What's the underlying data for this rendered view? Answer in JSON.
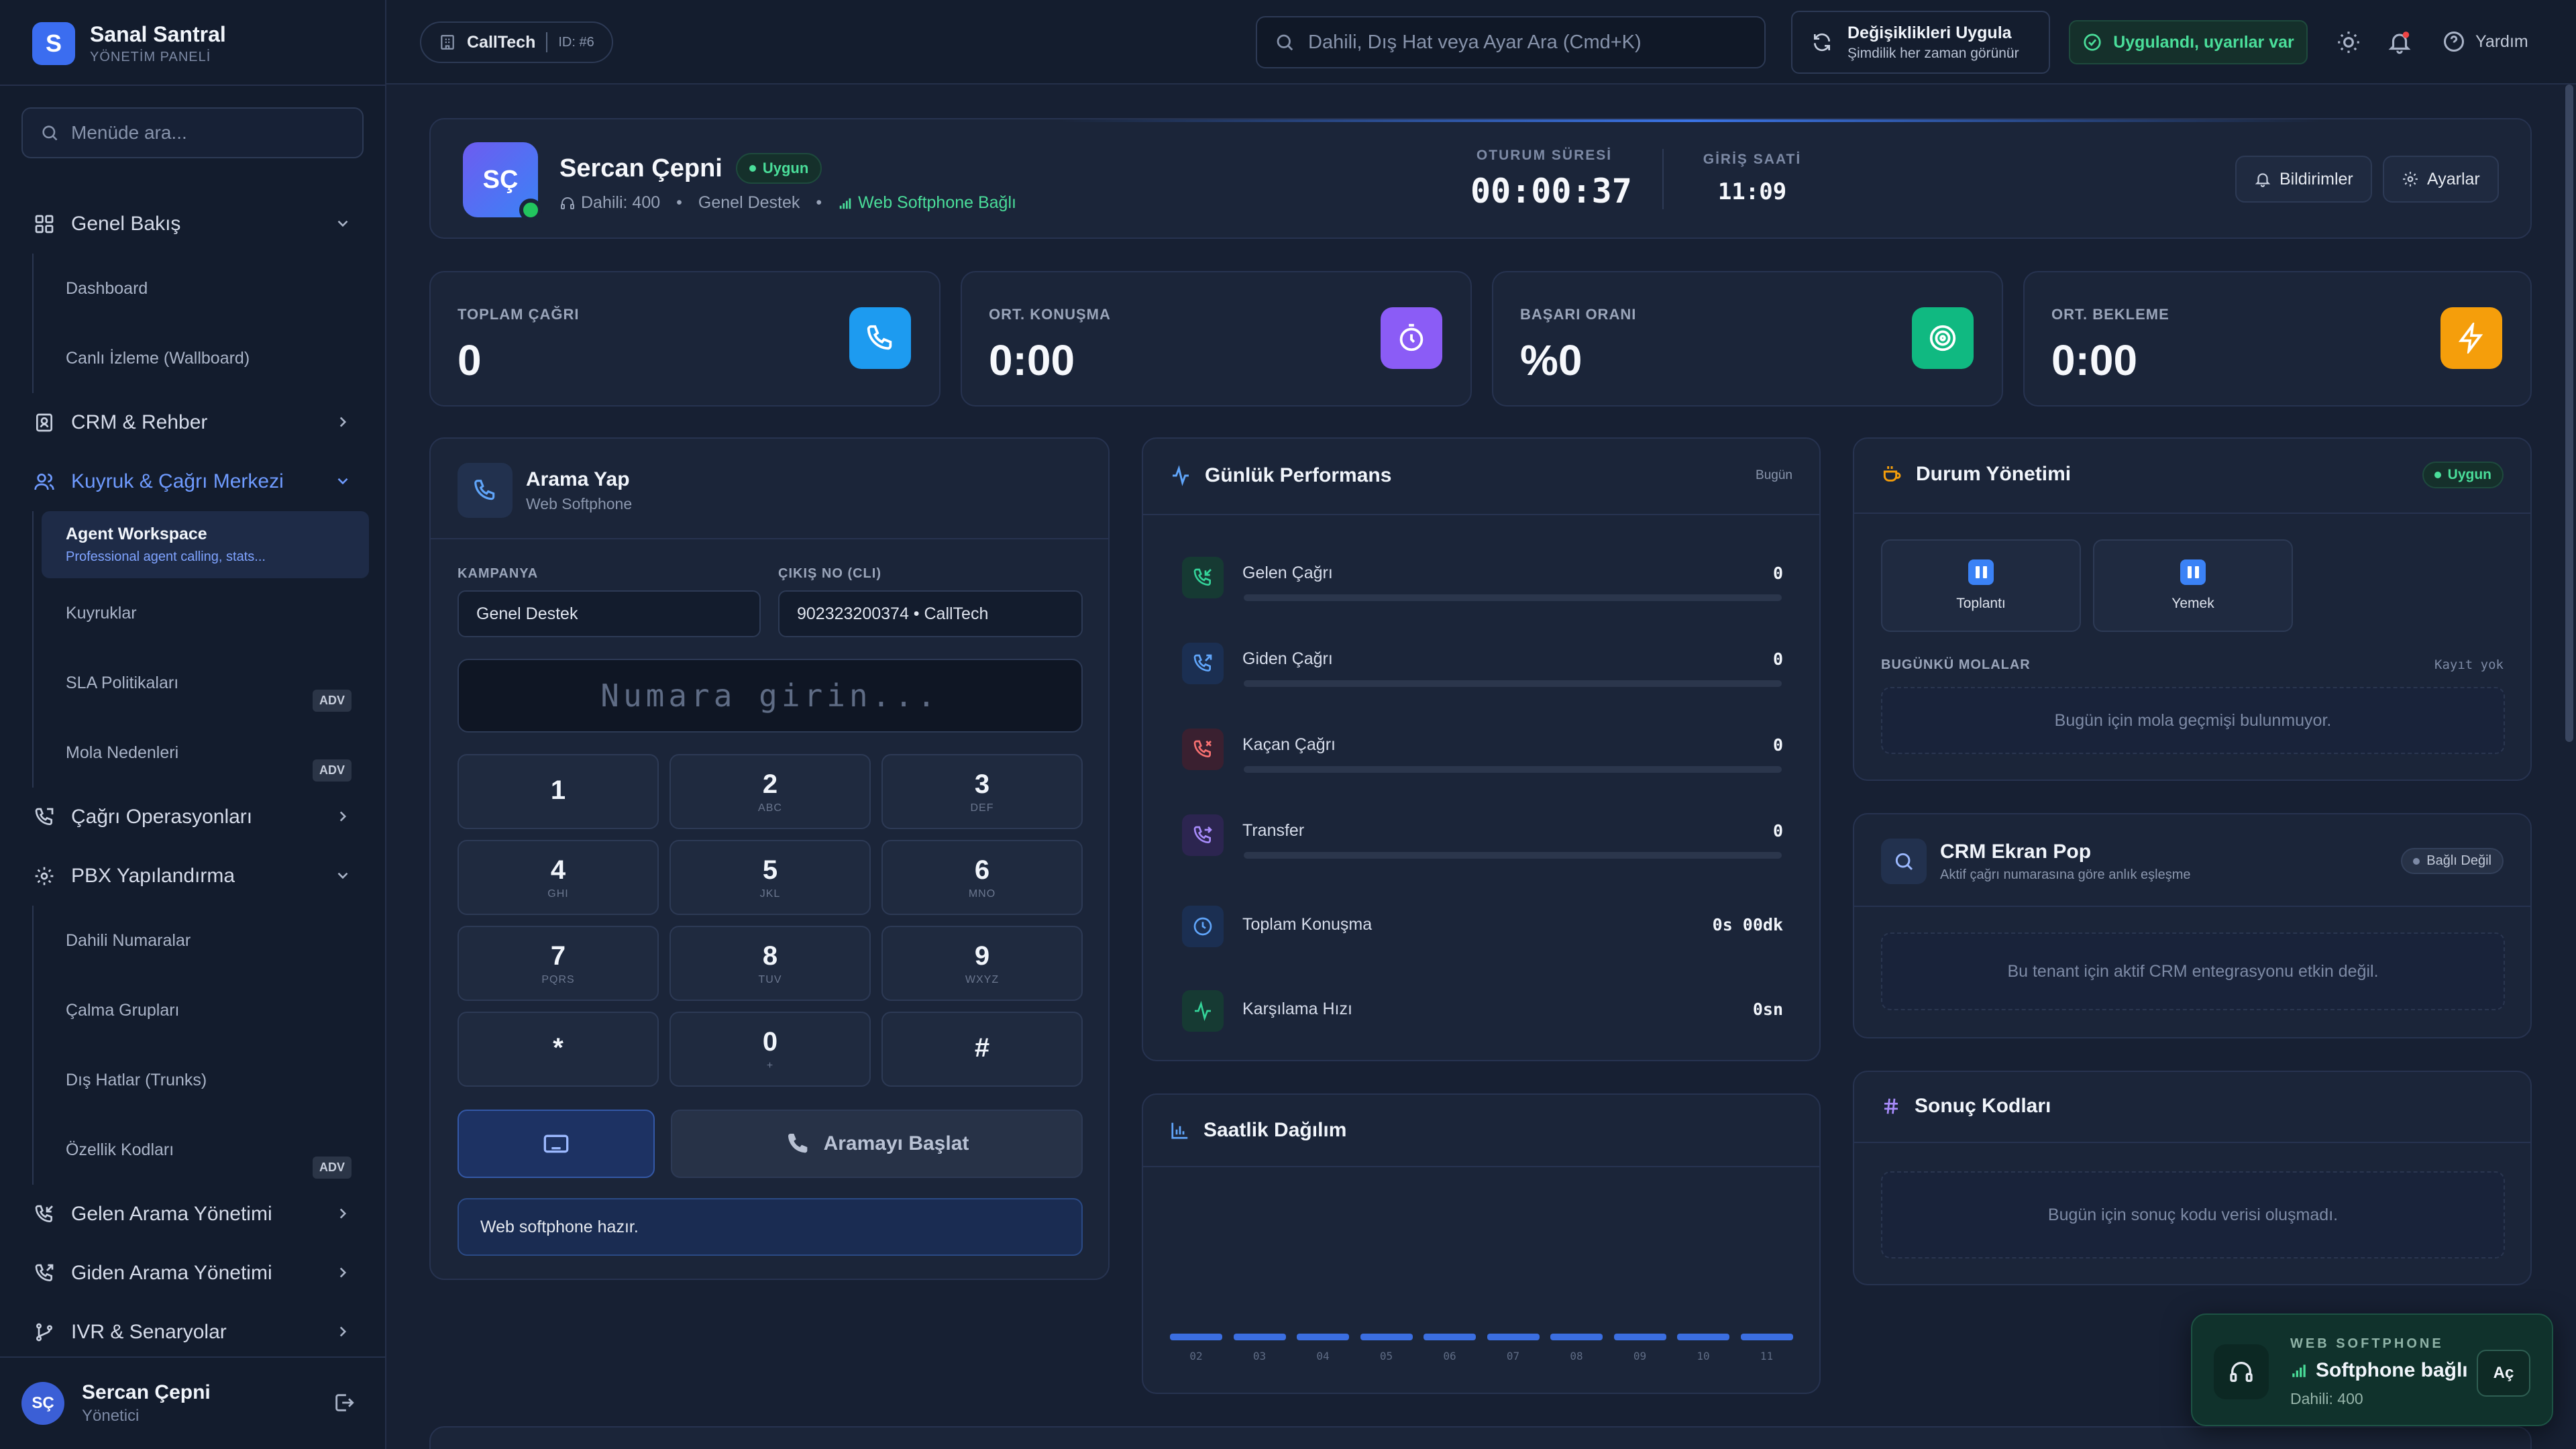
{
  "brand": {
    "logo_letter": "S",
    "name": "Sanal Santral",
    "subtitle": "YÖNETİM PANELİ"
  },
  "sidebar": {
    "search_placeholder": "Menüde ara...",
    "groups": [
      {
        "label": "Genel Bakış",
        "icon": "grid-icon",
        "expanded": true,
        "items": [
          {
            "label": "Dashboard"
          },
          {
            "label": "Canlı İzleme (Wallboard)"
          }
        ]
      },
      {
        "label": "CRM & Rehber",
        "icon": "contact-book-icon",
        "expanded": false
      },
      {
        "label": "Kuyruk & Çağrı Merkezi",
        "icon": "users-icon",
        "expanded": true,
        "active": true,
        "items": [
          {
            "label": "Agent Workspace",
            "sub": "Professional agent calling, stats...",
            "selected": true
          },
          {
            "label": "Kuyruklar"
          },
          {
            "label": "SLA Politikaları",
            "badge": "ADV"
          },
          {
            "label": "Mola Nedenleri",
            "badge": "ADV"
          }
        ]
      },
      {
        "label": "Çağrı Operasyonları",
        "icon": "phone-icon",
        "expanded": false
      },
      {
        "label": "PBX Yapılandırma",
        "icon": "gear-icon",
        "expanded": true,
        "items": [
          {
            "label": "Dahili Numaralar"
          },
          {
            "label": "Çalma Grupları"
          },
          {
            "label": "Dış Hatlar (Trunks)"
          },
          {
            "label": "Özellik Kodları",
            "badge": "ADV"
          }
        ]
      },
      {
        "label": "Gelen Arama Yönetimi",
        "icon": "phone-incoming-icon",
        "expanded": false
      },
      {
        "label": "Giden Arama Yönetimi",
        "icon": "phone-outgoing-icon",
        "expanded": false
      },
      {
        "label": "IVR & Senaryolar",
        "icon": "branch-icon",
        "expanded": false
      }
    ],
    "user": {
      "initials": "SÇ",
      "name": "Sercan Çepni",
      "role": "Yönetici"
    }
  },
  "topbar": {
    "tenant": "CallTech",
    "tenant_id": "ID: #6",
    "search_placeholder": "Dahili, Dış Hat veya Ayar Ara (Cmd+K)",
    "apply_title": "Değişiklikleri Uygula",
    "apply_sub": "Şimdilik her zaman görünür",
    "status": "Uygulandı, uyarılar var",
    "help": "Yardım"
  },
  "profile": {
    "initials": "SÇ",
    "name": "Sercan Çepni",
    "status": "Uygun",
    "extension": "Dahili: 400",
    "queue": "Genel Destek",
    "softphone": "Web Softphone Bağlı",
    "session_label": "OTURUM SÜRESİ",
    "session_value": "00:00:37",
    "login_label": "GİRİŞ SAATİ",
    "login_value": "11:09",
    "notifications_btn": "Bildirimler",
    "settings_btn": "Ayarlar"
  },
  "stats": [
    {
      "label": "TOPLAM ÇAĞRI",
      "value": "0",
      "icon": "phone-icon",
      "color": "#1d9bf0"
    },
    {
      "label": "ORT. KONUŞMA",
      "value": "0:00",
      "icon": "stopwatch-icon",
      "color": "#8b5cf6"
    },
    {
      "label": "BAŞARI ORANI",
      "value": "%0",
      "icon": "target-icon",
      "color": "#10b981"
    },
    {
      "label": "ORT. BEKLEME",
      "value": "0:00",
      "icon": "lightning-icon",
      "color": "#f59e0b"
    }
  ],
  "dialer": {
    "title": "Arama Yap",
    "subtitle": "Web Softphone",
    "campaign_label": "KAMPANYA",
    "campaign_value": "Genel Destek",
    "cli_label": "ÇIKIŞ NO (CLI)",
    "cli_value": "902323200374 • CallTech",
    "number_placeholder": "Numara girin...",
    "keys": [
      {
        "d": "1",
        "s": ""
      },
      {
        "d": "2",
        "s": "ABC"
      },
      {
        "d": "3",
        "s": "DEF"
      },
      {
        "d": "4",
        "s": "GHI"
      },
      {
        "d": "5",
        "s": "JKL"
      },
      {
        "d": "6",
        "s": "MNO"
      },
      {
        "d": "7",
        "s": "PQRS"
      },
      {
        "d": "8",
        "s": "TUV"
      },
      {
        "d": "9",
        "s": "WXYZ"
      },
      {
        "d": "*",
        "s": ""
      },
      {
        "d": "0",
        "s": "+"
      },
      {
        "d": "#",
        "s": ""
      }
    ],
    "call_button": "Aramayı Başlat",
    "ready_text": "Web softphone hazır."
  },
  "performance": {
    "title": "Günlük Performans",
    "period": "Bugün",
    "rows": [
      {
        "label": "Gelen Çağrı",
        "value": "0",
        "icon": "phone-incoming-icon",
        "color": "#34d399",
        "bg": "#163a33",
        "bar": true
      },
      {
        "label": "Giden Çağrı",
        "value": "0",
        "icon": "phone-outgoing-icon",
        "color": "#60a5fa",
        "bg": "#1b2f52",
        "bar": true
      },
      {
        "label": "Kaçan Çağrı",
        "value": "0",
        "icon": "phone-missed-icon",
        "color": "#f87171",
        "bg": "#3a2030",
        "bar": true
      },
      {
        "label": "Transfer",
        "value": "0",
        "icon": "phone-forward-icon",
        "color": "#a78bfa",
        "bg": "#2c2550",
        "bar": true
      },
      {
        "label": "Toplam Konuşma",
        "value": "0s 00dk",
        "icon": "clock-icon",
        "color": "#60a5fa",
        "bg": "#1b2f52",
        "bar": false
      },
      {
        "label": "Karşılama Hızı",
        "value": "0sn",
        "icon": "activity-icon",
        "color": "#34d399",
        "bg": "#163a33",
        "bar": false
      }
    ]
  },
  "hourly": {
    "title": "Saatlik Dağılım",
    "hours": [
      "02",
      "03",
      "04",
      "05",
      "06",
      "07",
      "08",
      "09",
      "10",
      "11"
    ]
  },
  "durum": {
    "title": "Durum Yönetimi",
    "status": "Uygun",
    "breaks": [
      {
        "label": "Toplantı"
      },
      {
        "label": "Yemek"
      }
    ],
    "breaks_label": "BUGÜNKÜ MOLALAR",
    "breaks_count": "Kayıt yok",
    "breaks_empty": "Bugün için mola geçmişi bulunmuyor."
  },
  "crm": {
    "title": "CRM Ekran Pop",
    "subtitle": "Aktif çağrı numarasına göre anlık eşleşme",
    "status": "Bağlı Değil",
    "empty": "Bu tenant için aktif CRM entegrasyonu etkin değil."
  },
  "sonuc": {
    "title": "Sonuç Kodları",
    "empty": "Bugün için sonuç kodu verisi oluşmadı."
  },
  "softphone_widget": {
    "kicker": "WEB SOFTPHONE",
    "status": "Softphone bağlı",
    "extension": "Dahili: 400",
    "open_btn": "Aç"
  }
}
